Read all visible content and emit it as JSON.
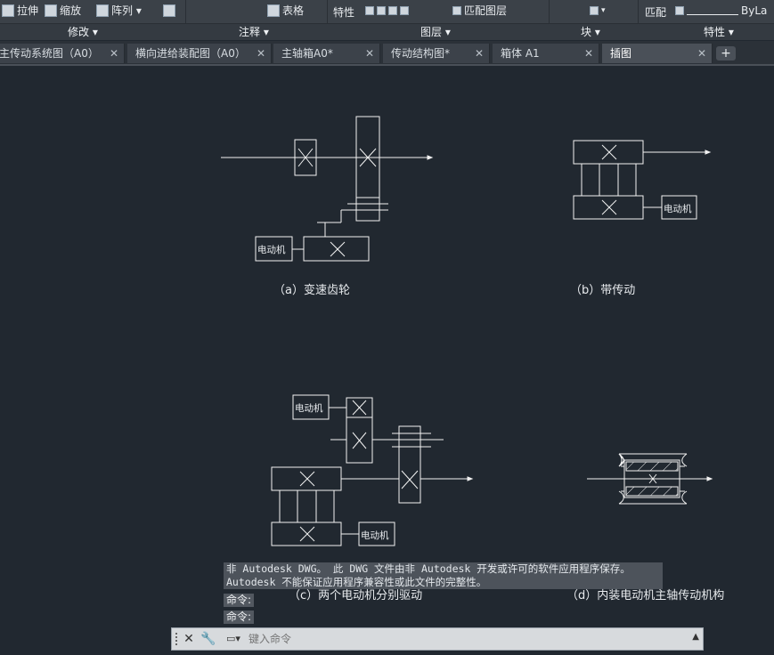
{
  "ribbon": {
    "tools": [
      {
        "label": "拉伸",
        "icon": "stretch-icon"
      },
      {
        "label": "缩放",
        "icon": "scale-icon"
      },
      {
        "label": "阵列 ▾",
        "icon": "array-icon"
      },
      {
        "label": "",
        "icon": "offset-icon"
      },
      {
        "label": "表格",
        "icon": "table-icon"
      },
      {
        "label": "特性",
        "icon": "layer-properties-icon"
      },
      {
        "label": "匹配图层",
        "icon": "match-layer-icon"
      },
      {
        "label": "匹配",
        "icon": "match-properties-icon"
      },
      {
        "label": "ByLa",
        "icon": "linetype-icon"
      }
    ],
    "panels": [
      "修改 ▾",
      "注释 ▾",
      "图层 ▾",
      "块 ▾",
      "特性 ▾"
    ]
  },
  "tabs": [
    {
      "label": "主传动系统图（A0）",
      "active": false
    },
    {
      "label": "横向进给装配图（A0）",
      "active": false
    },
    {
      "label": "主轴箱A0*",
      "active": false
    },
    {
      "label": "传动结构图*",
      "active": false
    },
    {
      "label": "箱体 A1",
      "active": false
    },
    {
      "label": "插图",
      "active": true
    }
  ],
  "tab_close": "✕",
  "tab_add": "+",
  "drawing": {
    "motor_label": "电动机",
    "captions": {
      "a": "（a）变速齿轮",
      "b": "（b）带传动",
      "c": "（c）两个电动机分别驱动",
      "d": "（d）内装电动机主轴传动机构"
    }
  },
  "command": {
    "history": [
      "非 Autodesk DWG。  此 DWG 文件由非 Autodesk 开发或许可的软件应用程序保存。",
      "Autodesk 不能保证应用程序兼容性或此文件的完整性。"
    ],
    "prompts": [
      "命令:",
      "命令:"
    ],
    "placeholder": "键入命令"
  }
}
